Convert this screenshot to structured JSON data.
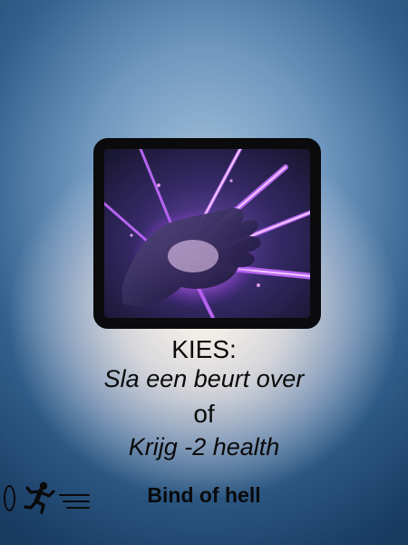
{
  "card": {
    "art_icon": "purple-energy-hand-icon",
    "choose_label": "KIES:",
    "option_a": "Sla een beurt over",
    "or_label": "of",
    "option_b": "Krijg -2 health",
    "title": "Bind of hell",
    "cost_icon": "zero-cost-oval-icon",
    "type_icon": "running-person-icon",
    "colors": {
      "art_frame": "#0b0b0d",
      "magic_purple": "#c040ff",
      "text": "#0a0a0a"
    }
  }
}
